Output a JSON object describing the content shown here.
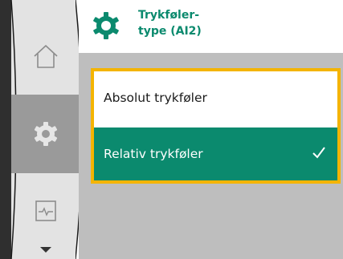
{
  "header": {
    "title": "Trykføler-\ntype (AI2)",
    "icon": "settings-gear-icon"
  },
  "sidebar": {
    "items": [
      {
        "icon": "home-icon",
        "selected": false
      },
      {
        "icon": "settings-gear-icon",
        "selected": true
      },
      {
        "icon": "monitor-pulse-icon",
        "selected": false
      }
    ],
    "scroll_indicator": "chevron-down-icon"
  },
  "options": [
    {
      "label": "Absolut trykføler",
      "selected": false
    },
    {
      "label": "Relativ trykføler",
      "selected": true
    }
  ],
  "colors": {
    "accent": "#0b8a6e",
    "focus_border": "#f4b400",
    "content_bg": "#bebebe",
    "rail_bg": "#e3e3e3",
    "rail_selected": "#9a9a9a"
  }
}
